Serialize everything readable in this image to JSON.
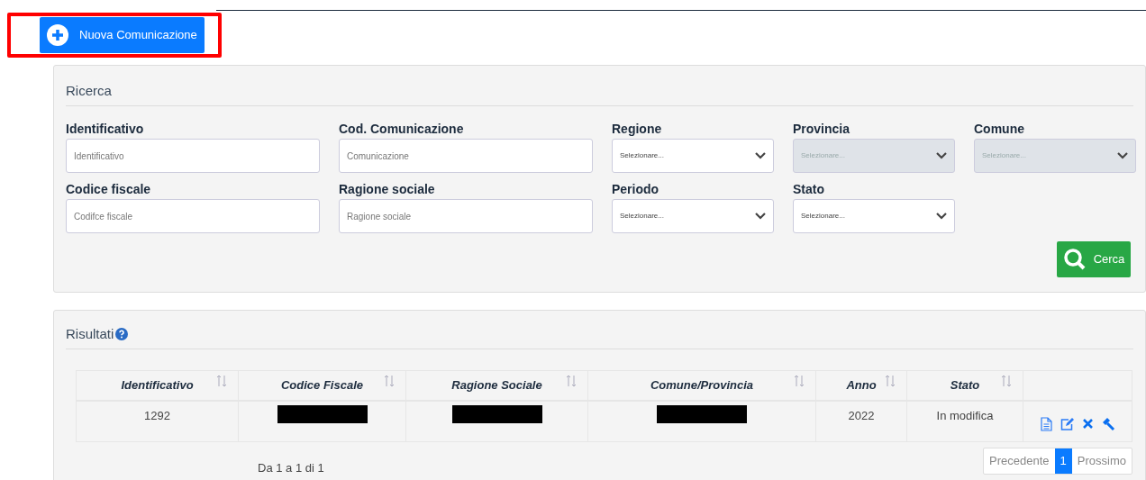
{
  "new_button": {
    "label": "Nuova Comunicazione",
    "highlighted": true
  },
  "search": {
    "title": "Ricerca",
    "fields": [
      {
        "kind": "input",
        "label": "Identificativo",
        "placeholder": "Identificativo"
      },
      {
        "kind": "input",
        "label": "Cod. Comunicazione",
        "placeholder": "Comunicazione"
      },
      {
        "kind": "select",
        "label": "Regione",
        "value": "Selezionare...",
        "disabled": false
      },
      {
        "kind": "select",
        "label": "Provincia",
        "value": "Selezionare...",
        "disabled": true
      },
      {
        "kind": "select",
        "label": "Comune",
        "value": "Selezionare...",
        "disabled": true
      },
      {
        "kind": "input",
        "label": "Codice fiscale",
        "placeholder": "Codifce fiscale"
      },
      {
        "kind": "input",
        "label": "Ragione sociale",
        "placeholder": "Ragione sociale"
      },
      {
        "kind": "select",
        "label": "Periodo",
        "value": "Selezionare...",
        "disabled": false
      },
      {
        "kind": "select",
        "label": "Stato",
        "value": "Selezionare...",
        "disabled": false
      }
    ],
    "button": "Cerca"
  },
  "results": {
    "title": "Risultati",
    "table": {
      "columns": [
        "Identificativo",
        "Codice Fiscale",
        "Ragione Sociale",
        "Comune/Provincia",
        "Anno",
        "Stato"
      ],
      "rows": [
        {
          "cells": [
            {
              "kind": "text",
              "text": "1292"
            },
            {
              "kind": "redacted"
            },
            {
              "kind": "redacted"
            },
            {
              "kind": "redacted"
            },
            {
              "kind": "text",
              "text": "2022"
            },
            {
              "kind": "text",
              "text": "In modifica"
            }
          ]
        }
      ]
    },
    "info": "Da 1 a 1 di 1",
    "pagination": [
      {
        "label": "Precedente",
        "selected": false
      },
      {
        "label": "1",
        "selected": true
      },
      {
        "label": "Prossimo",
        "selected": false
      }
    ]
  }
}
